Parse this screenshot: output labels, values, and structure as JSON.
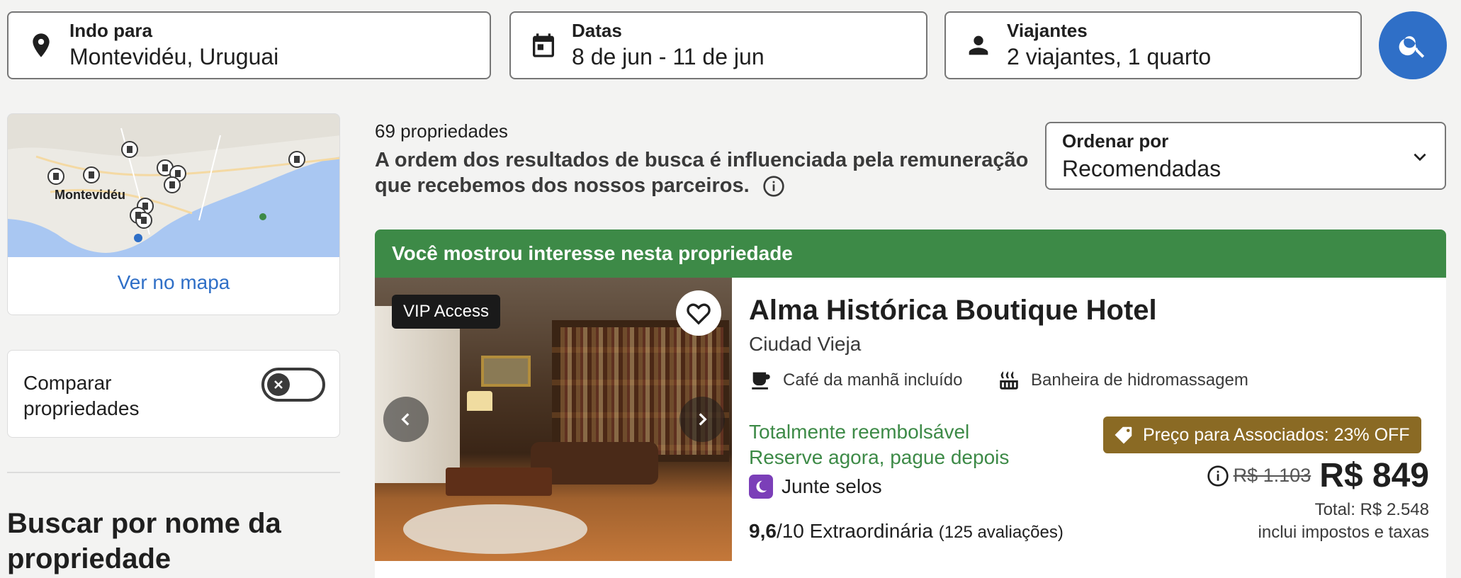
{
  "search": {
    "destination": {
      "label": "Indo para",
      "value": "Montevidéu, Uruguai",
      "icon": "location-pin-icon"
    },
    "dates": {
      "label": "Datas",
      "value": "8 de jun - 11 de jun",
      "icon": "calendar-icon"
    },
    "travelers": {
      "label": "Viajantes",
      "value": "2 viajantes, 1 quarto",
      "icon": "person-icon"
    },
    "button_icon": "search-icon"
  },
  "map": {
    "city_label": "Montevidéu",
    "link": "Ver no mapa"
  },
  "compare": {
    "label": "Comparar propriedades",
    "enabled": false
  },
  "search_by_name": {
    "title": "Buscar por nome da propriedade"
  },
  "results": {
    "count": "69 propriedades",
    "disclaimer": "A ordem dos resultados de busca é influenciada pela remuneração que recebemos dos nossos parceiros."
  },
  "sort": {
    "label": "Ordenar por",
    "value": "Recomendadas"
  },
  "listing": {
    "banner": "Você mostrou interesse nesta propriedade",
    "badge": "VIP Access",
    "name": "Alma Histórica Boutique Hotel",
    "area": "Ciudad Vieja",
    "amenities": [
      "Café da manhã incluído",
      "Banheira de hidromassagem"
    ],
    "refund": "Totalmente reembolsável",
    "pay_later": "Reserve agora, pague depois",
    "stamps": "Junte selos",
    "rating_score": "9,6",
    "rating_scale": "/10",
    "rating_text": "Extraordinária",
    "reviews": "(125 avaliações)",
    "deal": "Preço para Associados: 23% OFF",
    "old_price": "R$ 1.103",
    "price": "R$ 849",
    "total": "Total: R$ 2.548",
    "taxes": "inclui impostos e taxas"
  },
  "colors": {
    "accent": "#2f6fc7",
    "banner_green": "#3d8a47",
    "deal_gold": "#8a6a24",
    "stamps_purple": "#7b3fb8"
  }
}
